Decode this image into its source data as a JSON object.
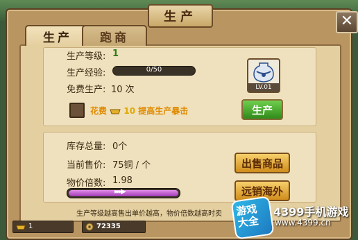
{
  "window": {
    "title": "生产"
  },
  "tabs": [
    {
      "label": "生产",
      "active": true
    },
    {
      "label": "跑商",
      "active": false
    }
  ],
  "production": {
    "level_label": "生产等级:",
    "level_value": "1",
    "exp_label": "生产经验:",
    "exp_value": "0/50",
    "exp_progress": 0,
    "free_label": "免费生产:",
    "free_value": "10 次",
    "item_level": "LV.01",
    "tip_prefix": "花费",
    "tip_amount": "10",
    "tip_suffix": "提高生产暴击",
    "produce_button": "生产"
  },
  "market": {
    "stock_label": "库存总量:",
    "stock_value": "0个",
    "price_label": "当前售价:",
    "price_value": "75铜 / 个",
    "multiplier_label": "物价倍数:",
    "multiplier_value": "1.98",
    "sell_button": "出售商品",
    "export_button": "远销海外"
  },
  "note": "生产等级越高售出单价越高，物价倍数越高时卖",
  "status": {
    "gold": "1",
    "coins": "72335"
  },
  "watermark": {
    "logo_line1": "游戏",
    "logo_line2": "大全",
    "brand": "4399手机游戏",
    "url": "www.4399.cn"
  },
  "colors": {
    "accent_green": "#2e7b1a",
    "tip_orange": "#e08a00",
    "price_bar": "#a13cb6"
  }
}
